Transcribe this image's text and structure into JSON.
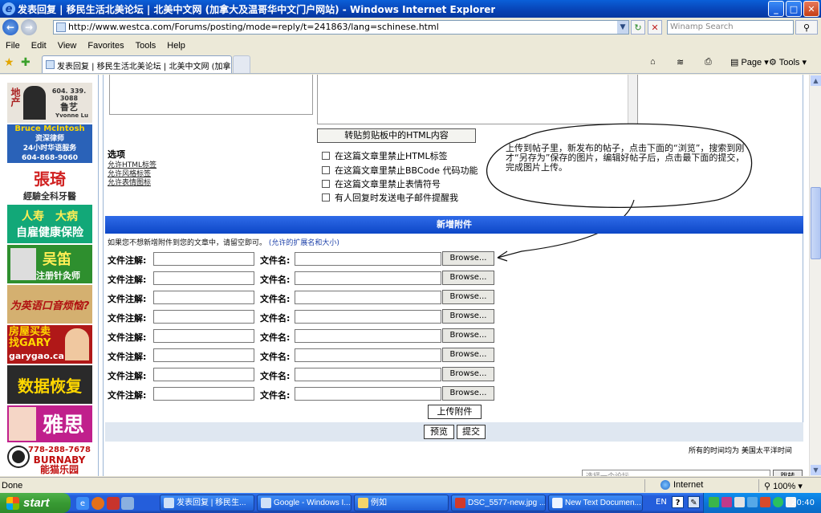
{
  "window": {
    "title": "发表回复 | 移民生活北美论坛 | 北美中文网 (加拿大及温哥华中文门户网站) - Windows Internet Explorer",
    "ie_letter": "e",
    "min": "_",
    "max": "□",
    "close": "✕"
  },
  "addressbar": {
    "back": "←",
    "forward": "→",
    "url": "http://www.westca.com/Forums/posting/mode=reply/t=241863/lang=schinese.html",
    "refresh": "↻",
    "stop": "✕",
    "search_placeholder": "Winamp Search",
    "search_go": "⚲"
  },
  "menu": [
    "File",
    "Edit",
    "View",
    "Favorites",
    "Tools",
    "Help"
  ],
  "tabs": {
    "active_title": "发表回复 | 移民生活北美论坛 | 北美中文网 (加拿..."
  },
  "toolbar": {
    "home": "⌂",
    "feeds": "≋",
    "print": "⎙",
    "page": "Page",
    "tools": "Tools"
  },
  "ads": [
    {
      "id": "lu",
      "text": "地产 604.339.3088 鲁艺 Yvonne Lu",
      "bg": "#b03020"
    },
    {
      "id": "bruce",
      "text": "Bruce McIntosh 资深律师 24小时华语服务 604-868-9060",
      "bg": "#2a62b8"
    },
    {
      "id": "zhang",
      "text": "張琦 經驗全科牙醫",
      "bg": "#ffffff"
    },
    {
      "id": "insurance",
      "text": "人寿  大病 自雇健康保险",
      "bg": "#10a070"
    },
    {
      "id": "wu",
      "text": "吴笛 注册针灸师",
      "bg": "#2c8a2c"
    },
    {
      "id": "english",
      "text": "为英语口音烦恼?",
      "bg": "#c9a66b"
    },
    {
      "id": "gary",
      "text": "房屋买卖 找GARY garygao.ca",
      "bg": "#b01818"
    },
    {
      "id": "data",
      "text": "数据恢复",
      "bg": "#2a2a2a"
    },
    {
      "id": "ielts",
      "text": "雅思",
      "bg": "#c0208c"
    },
    {
      "id": "panda",
      "text": "778-288-7678 BURNABY 能猫乐园",
      "bg": "#ffffff"
    }
  ],
  "form": {
    "copy_clipboard_btn": "转贴剪贴板中的HTML内容",
    "options_title": "选项",
    "option_links": [
      "允许HTML标签",
      "允许风格标签",
      "允许表情图标"
    ],
    "checkboxes": [
      "在这篇文章里禁止HTML标签",
      "在这篇文章里禁止BBCode 代码功能",
      "在这篇文章里禁止表情符号",
      "有人回复时发送电子邮件提醒我"
    ],
    "callout_text": "上传到帖子里，新发布的帖子，点击下面的“浏览”，搜索到刚才“另存为”保存的图片，编辑好帖子后，点击最下面的提交，完成图片上传。",
    "attach_header": "新增附件",
    "attach_note": "如果您不想新增附件到您的文章中，请留空即可。",
    "attach_note_link": "(允许的扩展名和大小)",
    "rows": [
      {
        "comment_label": "文件注解:",
        "file_label": "文件名:",
        "browse": "Browse..."
      },
      {
        "comment_label": "文件注解:",
        "file_label": "文件名:",
        "browse": "Browse..."
      },
      {
        "comment_label": "文件注解:",
        "file_label": "文件名:",
        "browse": "Browse..."
      },
      {
        "comment_label": "文件注解:",
        "file_label": "文件名:",
        "browse": "Browse..."
      },
      {
        "comment_label": "文件注解:",
        "file_label": "文件名:",
        "browse": "Browse..."
      },
      {
        "comment_label": "文件注解:",
        "file_label": "文件名:",
        "browse": "Browse..."
      },
      {
        "comment_label": "文件注解:",
        "file_label": "文件名:",
        "browse": "Browse..."
      },
      {
        "comment_label": "文件注解:",
        "file_label": "文件名:",
        "browse": "Browse..."
      }
    ],
    "upload_btn": "上传附件",
    "preview_btn": "预览",
    "submit_btn": "提交",
    "timezone_text": "所有的时间均为 美国太平洋时间",
    "jump_text": "选择一个论坛",
    "jump_btn": "跳转"
  },
  "status": {
    "text": "Done",
    "zone": "Internet",
    "zoom": "100%"
  },
  "taskbar": {
    "start": "start",
    "tasks": [
      "发表回复 | 移民生...",
      "Google - Windows I...",
      "例如",
      "DSC_5577-new.jpg ...",
      "New Text Documen..."
    ],
    "lang": "EN",
    "clock": "20:40"
  },
  "colors": {
    "ie_titlebar": "#0842b4",
    "attach_header": "#1f5bd6",
    "taskbar": "#245edb",
    "start_green": "#389a33"
  }
}
